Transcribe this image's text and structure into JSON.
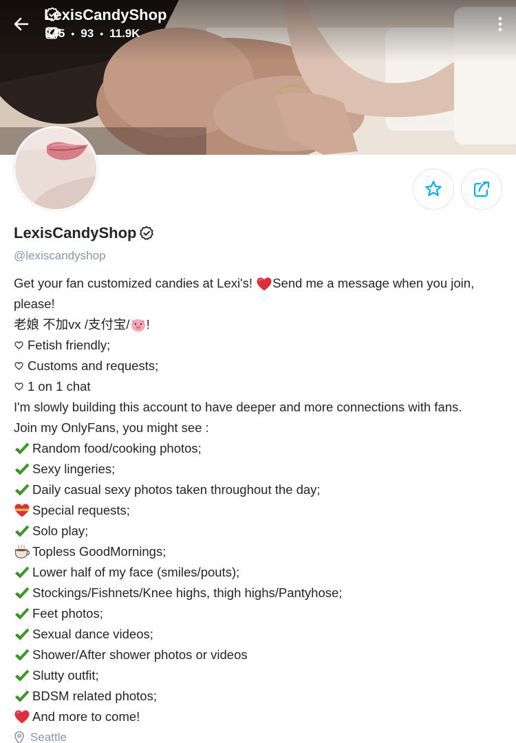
{
  "header": {
    "back_icon": "arrow-left-icon",
    "title": "LexisCandyShop",
    "verified_icon": "verified-badge-icon",
    "stats": {
      "photos": "745",
      "videos": "93",
      "likes": "11.9K",
      "separator": "•"
    },
    "more_icon": "more-vertical-icon"
  },
  "profile": {
    "name": "LexisCandyShop",
    "handle": "@lexiscandyshop",
    "location": "Seattle",
    "actions": {
      "favorite_icon": "star-icon",
      "share_icon": "share-icon"
    }
  },
  "bio": {
    "intro_a": "Get your fan customized candies at Lexi's! ",
    "intro_b": "Send me a message when you join, please!",
    "cn_a": "老娘 不加vx /支付宝/",
    "cn_b": "!",
    "hearts": [
      "Fetish friendly;",
      "Customs and requests;",
      "1 on 1 chat"
    ],
    "paragraph_1": "I'm slowly building this account to have deeper and more connections with fans.",
    "paragraph_2": "Join my OnlyFans, you might see :",
    "items": [
      {
        "icon": "check",
        "text": "Random food/cooking photos;"
      },
      {
        "icon": "check",
        "text": "Sexy lingeries;"
      },
      {
        "icon": "check",
        "text": "Daily casual sexy photos taken throughout the day;"
      },
      {
        "icon": "heart-ribbon",
        "text": "Special requests;"
      },
      {
        "icon": "check",
        "text": "Solo play;"
      },
      {
        "icon": "coffee",
        "text": "Topless GoodMornings;"
      },
      {
        "icon": "check",
        "text": "Lower half of my face (smiles/pouts);"
      },
      {
        "icon": "check",
        "text": "Stockings/Fishnets/Knee highs, thigh highs/Pantyhose;"
      },
      {
        "icon": "check",
        "text": "Feet photos;"
      },
      {
        "icon": "check",
        "text": "Sexual dance videos;"
      },
      {
        "icon": "check",
        "text": "Shower/After shower photos or videos"
      },
      {
        "icon": "check",
        "text": "Slutty outfit;"
      },
      {
        "icon": "check",
        "text": "BDSM related photos;"
      },
      {
        "icon": "heart",
        "text": "And more to come!"
      }
    ]
  },
  "colors": {
    "accent": "#00aff0",
    "text": "#242529",
    "muted": "#8a96a3",
    "check_green": "#3b9a2a",
    "heart_red": "#e02d3c"
  }
}
